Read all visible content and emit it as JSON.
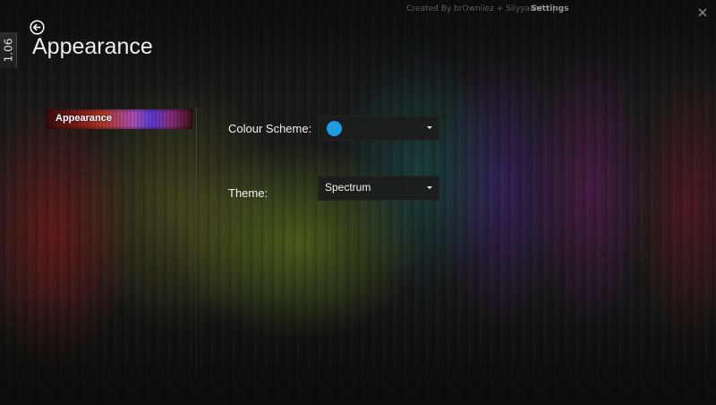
{
  "top_bar": {
    "credit": "Created By brOwniiez + Siiyyaahh",
    "settings_link": "Settings"
  },
  "version_tab": {
    "label": "1.06"
  },
  "header": {
    "title": "Appearance"
  },
  "nav": {
    "items": [
      {
        "label": "Appearance",
        "selected": true
      }
    ]
  },
  "settings": {
    "colour_scheme": {
      "label": "Colour Scheme:",
      "swatch_color": "#1e9be5"
    },
    "theme": {
      "label": "Theme:",
      "value": "Spectrum"
    }
  },
  "icons": {
    "back": "back-arrow-icon",
    "close": "close-icon",
    "dropdown": "chevron-down-icon"
  }
}
